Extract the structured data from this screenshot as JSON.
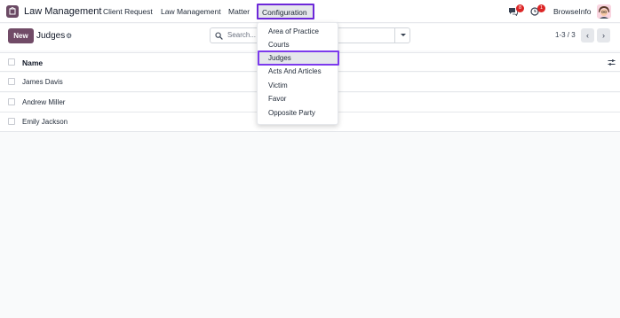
{
  "app": {
    "title": "Law Management",
    "icon": "law-app-icon"
  },
  "topnav": {
    "items": [
      {
        "label": "Client Request"
      },
      {
        "label": "Law Management"
      },
      {
        "label": "Matter"
      },
      {
        "label": "Configuration"
      }
    ],
    "active": "Configuration"
  },
  "systray": {
    "messages_count": "8",
    "activity_count": "1",
    "company": "BrowseInfo"
  },
  "control": {
    "new_label": "New",
    "breadcrumb": "Judges",
    "search_placeholder": "Search...",
    "pager": "1-3 / 3"
  },
  "table": {
    "header": "Name",
    "rows": [
      {
        "name": "James Davis"
      },
      {
        "name": "Andrew Miller"
      },
      {
        "name": "Emily Jackson"
      }
    ]
  },
  "dropdown": {
    "items": [
      {
        "label": "Area of Practice"
      },
      {
        "label": "Courts"
      },
      {
        "label": "Judges"
      },
      {
        "label": "Acts And Articles"
      },
      {
        "label": "Victim"
      },
      {
        "label": "Favor"
      },
      {
        "label": "Opposite Party"
      }
    ],
    "selected": "Judges"
  },
  "colors": {
    "brand": "#714b67",
    "highlight_border": "#7c3aed",
    "badge": "#dc2626"
  }
}
